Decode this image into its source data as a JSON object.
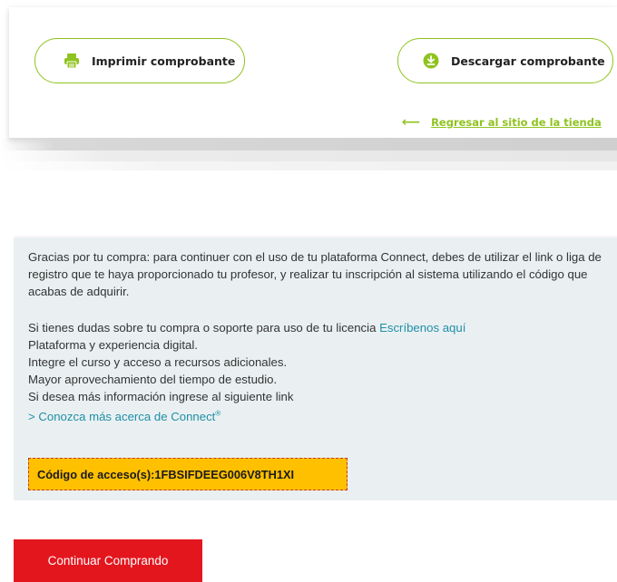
{
  "actions": {
    "print_label": "Imprimir comprobante",
    "download_label": "Descargar comprobante",
    "back_arrow": "⟵",
    "back_link": "Regresar al sitio de la tienda"
  },
  "info": {
    "paragraph1": "Gracias por tu compra: para continuer con el uso de tu plataforma Connect, debes de utilizar el link o liga de registro que te haya proporcionado tu profesor, y realizar tu inscripción al sistema utilizando el código que acabas de adquirir.",
    "support_text": "Si tienes dudas sobre tu compra o soporte para uso de tu licencia ",
    "support_link": "Escríbenos aquí",
    "lines": [
      "Plataforma y experiencia digital.",
      "Integre el curso y acceso a recursos adicionales.",
      "Mayor aprovechamiento del tiempo de estudio.",
      "Si desea más información ingrese al siguiente link"
    ],
    "connect_link": "> Conozca más acerca de Connect",
    "connect_mark": "®"
  },
  "access_code": {
    "label": "Código de acceso(s): ",
    "value": "1FBSIFDEEG006V8TH1XI"
  },
  "continue_label": "Continuar Comprando",
  "colors": {
    "accent_green": "#8fc31f",
    "info_bg": "#eaf0f2",
    "link_teal": "#1f8fa6",
    "code_bg": "#ffc000",
    "code_border": "#c0392b",
    "continue_red": "#e3161e"
  },
  "icons": {
    "print": "printer-icon",
    "download": "download-icon",
    "back": "arrow-left-icon"
  }
}
